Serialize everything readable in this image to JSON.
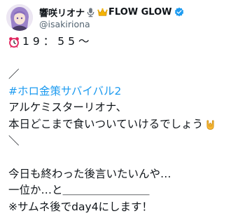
{
  "user": {
    "display_name": "響咲リオナ",
    "display_name_suffix": "FLOW GLOW",
    "handle": "@isakiriona",
    "name_icons": [
      "microphone-icon",
      "crown-icon"
    ],
    "verified_color": "#1d9bf0"
  },
  "tweet": {
    "time_icon": "alarm-clock-icon",
    "time_text": "19：55〜",
    "slash_open": "／",
    "hashtag": "#ホロ金策サバイバル2",
    "line_alchemist": "アルケミスターリオナ、",
    "line_today": "本日どこまで食いついていけるでしょう",
    "line_today_icon": "rock-hand-icon",
    "slash_close": "＼",
    "line_tired": "今日も終わった後言いたいんや…",
    "line_first": "一位か…と＿＿＿＿＿＿＿＿",
    "line_note": "※サムネ後でday4にします！"
  },
  "colors": {
    "text": "#0f1419",
    "secondary": "#536471",
    "link": "#1d9bf0"
  }
}
